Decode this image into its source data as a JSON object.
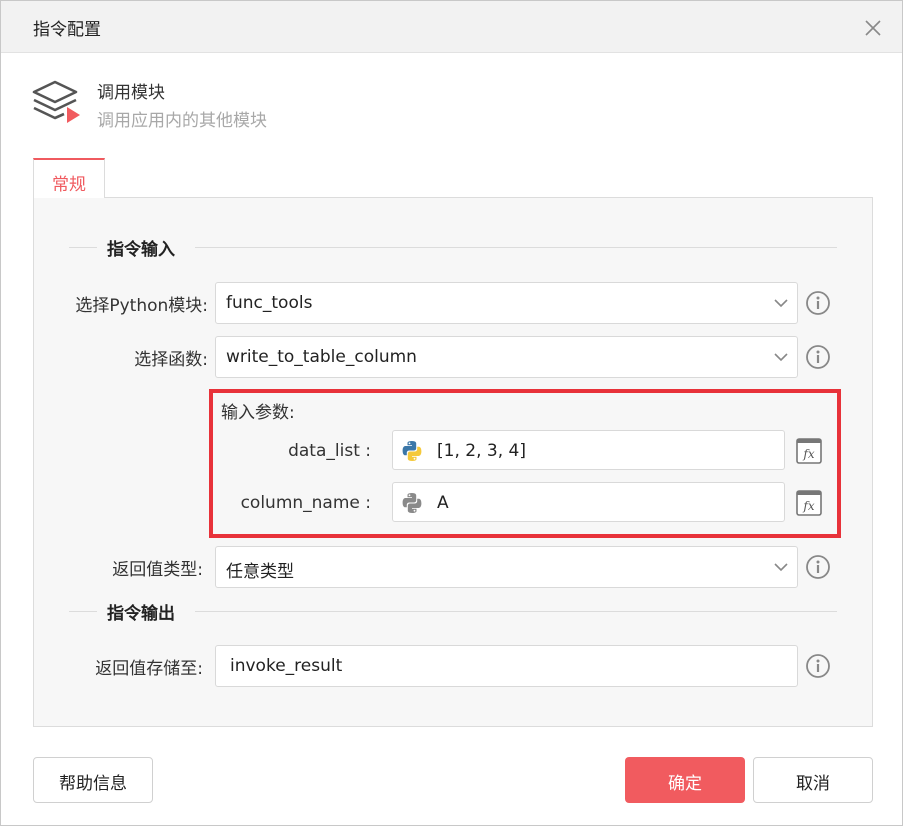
{
  "dialog": {
    "title": "指令配置"
  },
  "header": {
    "title": "调用模块",
    "subtitle": "调用应用内的其他模块",
    "icon": "layers-play-icon"
  },
  "tabs": [
    {
      "label": "常规",
      "active": true
    }
  ],
  "sections": {
    "input": "指令输入",
    "output": "指令输出"
  },
  "form": {
    "module": {
      "label": "选择Python模块:",
      "value": "func_tools"
    },
    "function": {
      "label": "选择函数:",
      "value": "write_to_table_column"
    },
    "params": {
      "title": "输入参数:",
      "data_list": {
        "label": "data_list :",
        "value": "[1, 2, 3, 4]"
      },
      "column_name": {
        "label": "column_name :",
        "value": "A"
      }
    },
    "return_type": {
      "label": "返回值类型:",
      "value": "任意类型"
    },
    "return_store": {
      "label": "返回值存储至:",
      "value": "invoke_result"
    }
  },
  "buttons": {
    "help": "帮助信息",
    "ok": "确定",
    "cancel": "取消"
  },
  "colors": {
    "accent": "#f15b5f",
    "highlight": "#e8323a"
  }
}
